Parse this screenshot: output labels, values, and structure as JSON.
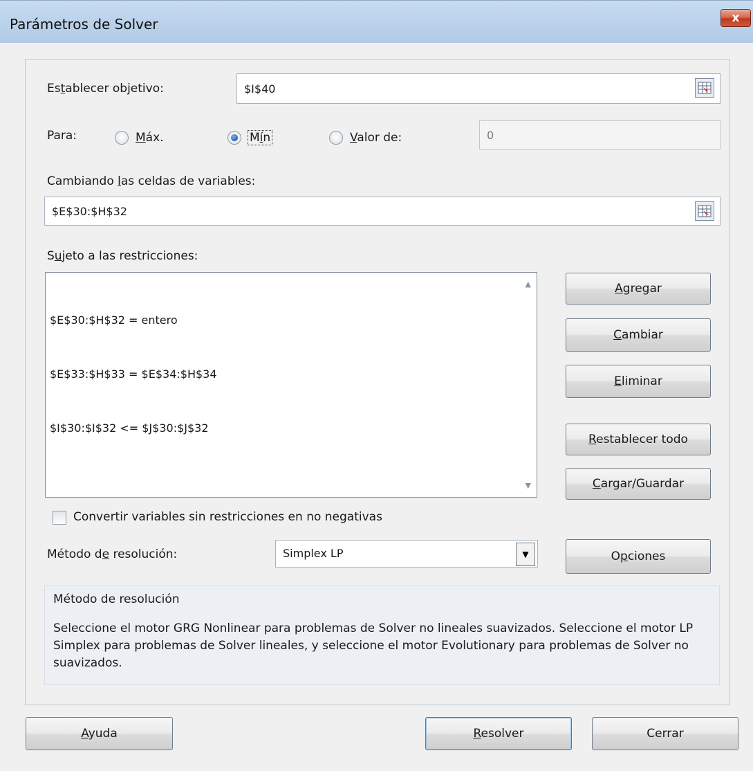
{
  "window": {
    "title": "Parámetros de Solver",
    "close_label": "x"
  },
  "objective": {
    "label": "Establecer objetivo:",
    "value": "$I$40"
  },
  "para": {
    "label": "Para:",
    "options": [
      {
        "label": "Máx.",
        "checked": false
      },
      {
        "label": "Mín",
        "checked": true
      },
      {
        "label": "Valor de:",
        "checked": false
      }
    ],
    "value_of": "0"
  },
  "variables": {
    "label": "Cambiando las celdas de variables:",
    "value": "$E$30:$H$32"
  },
  "constraints": {
    "label": "Sujeto a las restricciones:",
    "items": [
      "$E$30:$H$32 = entero",
      "$E$33:$H$33 = $E$34:$H$34",
      "$I$30:$I$32 <= $J$30:$J$32"
    ]
  },
  "side_buttons": {
    "add": "Agregar",
    "change": "Cambiar",
    "delete": "Eliminar",
    "reset": "Restablecer todo",
    "load_save": "Cargar/Guardar"
  },
  "nonneg": {
    "label": "Convertir variables sin restricciones en no negativas",
    "checked": false
  },
  "method": {
    "label": "Método de resolución:",
    "selected": "Simplex LP",
    "options_button": "Opciones"
  },
  "method_group": {
    "title": "Método de resolución",
    "description": "Seleccione el motor GRG Nonlinear para problemas de Solver no lineales suavizados. Seleccione el motor LP Simplex para problemas de Solver lineales, y seleccione el motor Evolutionary para problemas de Solver no suavizados."
  },
  "footer": {
    "help": "Ayuda",
    "solve": "Resolver",
    "close": "Cerrar"
  }
}
